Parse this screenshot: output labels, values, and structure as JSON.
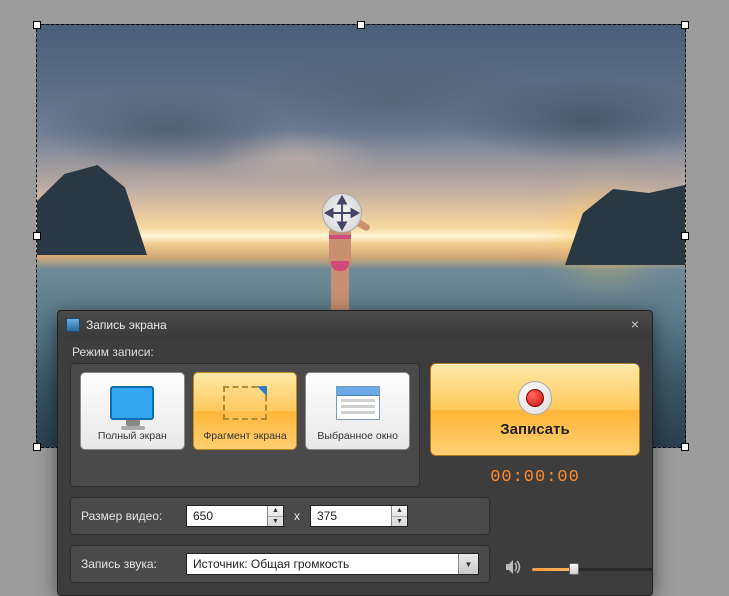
{
  "dialog": {
    "title": "Запись экрана",
    "mode_label": "Режим записи:",
    "modes": {
      "fullscreen": "Полный экран",
      "fragment": "Фрагмент экрана",
      "window": "Выбранное окно"
    },
    "record_label": "Записать",
    "timer": "00:00:00",
    "size_label": "Размер видео:",
    "size_width": "650",
    "size_sep": "x",
    "size_height": "375",
    "audio_label": "Запись звука:",
    "audio_source": "Источник: Общая громкость"
  },
  "colors": {
    "accent_orange": "#ffb638",
    "timer_orange": "#ff8a2a"
  }
}
